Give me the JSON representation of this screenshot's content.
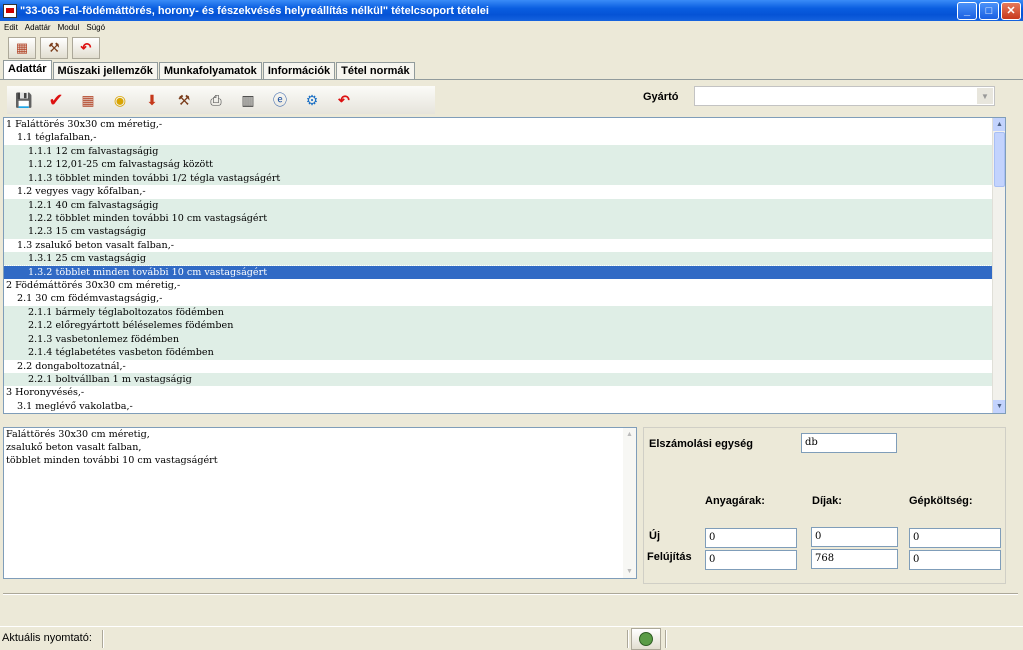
{
  "window": {
    "title": "\"33-063 Fal-födémáttörés, horony- és fészekvésés helyreállítás nélkül\" tételcsoport tételei",
    "minimize_glyph": "_",
    "maximize_glyph": "□",
    "close_glyph": "✕"
  },
  "menu": [
    "Edit",
    "Adattár",
    "Modul",
    "Súgó"
  ],
  "toolbar1": [
    {
      "icon": "bricks-icon",
      "glyph": "▦"
    },
    {
      "icon": "trowel-icon",
      "glyph": "⚒"
    },
    {
      "icon": "back-arrow-icon",
      "glyph": "↶"
    }
  ],
  "tabs": [
    "Adattár",
    "Műszaki jellemzők",
    "Munkafolyamatok",
    "Információk",
    "Tétel normák"
  ],
  "active_tab": "Adattár",
  "toolbar2": [
    {
      "icon": "save-icon",
      "glyph": "💾"
    },
    {
      "icon": "check-icon",
      "glyph": "✔"
    },
    {
      "icon": "bricks-icon",
      "glyph": "▦"
    },
    {
      "icon": "material-icon",
      "glyph": "◉"
    },
    {
      "icon": "import-icon",
      "glyph": "⬇"
    },
    {
      "icon": "tool-icon",
      "glyph": "⚒"
    },
    {
      "icon": "print-icon",
      "glyph": "⎙"
    },
    {
      "icon": "bar-chart-icon",
      "glyph": "▥"
    },
    {
      "icon": "internet-icon",
      "glyph": "ⓔ"
    },
    {
      "icon": "machine-icon",
      "glyph": "⚙"
    },
    {
      "icon": "back-arrow-icon",
      "glyph": "↶"
    }
  ],
  "gyarto": {
    "label": "Gyártó",
    "value": ""
  },
  "tree": [
    {
      "text": "1 Faláttörés 30x30 cm méretig,-",
      "level": 0,
      "alt": false
    },
    {
      "text": "1.1 téglafalban,-",
      "level": 1,
      "alt": false
    },
    {
      "text": "1.1.1 12 cm falvastagságig",
      "level": 2,
      "alt": true
    },
    {
      "text": "1.1.2 12,01-25 cm falvastagság között",
      "level": 2,
      "alt": true
    },
    {
      "text": "1.1.3 többlet minden további 1/2 tégla vastagságért",
      "level": 2,
      "alt": true
    },
    {
      "text": "1.2 vegyes vagy kőfalban,-",
      "level": 1,
      "alt": false
    },
    {
      "text": "1.2.1 40 cm falvastagságig",
      "level": 2,
      "alt": true
    },
    {
      "text": "1.2.2 többlet minden további 10 cm vastagságért",
      "level": 2,
      "alt": true
    },
    {
      "text": "1.2.3 15 cm vastagságig",
      "level": 2,
      "alt": true
    },
    {
      "text": "1.3 zsalukő beton vasalt falban,-",
      "level": 1,
      "alt": false
    },
    {
      "text": "1.3.1 25 cm vastagságig",
      "level": 2,
      "alt": true
    },
    {
      "text": "1.3.2 többlet minden további 10 cm vastagságért",
      "level": 2,
      "alt": false,
      "selected": true
    },
    {
      "text": "2 Födémáttörés 30x30 cm méretig,-",
      "level": 0,
      "alt": false
    },
    {
      "text": "2.1 30 cm födémvastagságig,-",
      "level": 1,
      "alt": false
    },
    {
      "text": "2.1.1 bármely téglaboltozatos födémben",
      "level": 2,
      "alt": true
    },
    {
      "text": "2.1.2 előregyártott béléselemes födémben",
      "level": 2,
      "alt": true
    },
    {
      "text": "2.1.3 vasbetonlemez födémben",
      "level": 2,
      "alt": true
    },
    {
      "text": "2.1.4 téglabetétes vasbeton födémben",
      "level": 2,
      "alt": true
    },
    {
      "text": "2.2 dongaboltozatnál,-",
      "level": 1,
      "alt": false
    },
    {
      "text": "2.2.1 boltvállban 1 m vastagságig",
      "level": 2,
      "alt": true
    },
    {
      "text": "3 Horonyvésés,-",
      "level": 0,
      "alt": false
    },
    {
      "text": "3.1 meglévő vakolatba,-",
      "level": 1,
      "alt": false
    }
  ],
  "description": [
    "Faláttörés 30x30 cm méretig,",
    "zsalukő beton vasalt falban,",
    "többlet minden további 10 cm vastagságért"
  ],
  "details": {
    "unit_label": "Elszámolási egység",
    "unit_value": "db",
    "col_material": "Anyagárak:",
    "col_fees": "Díjak:",
    "col_machine": "Gépköltség:",
    "row_new": "Új",
    "row_renovation": "Felújítás",
    "new": {
      "material": "0",
      "fees": "0",
      "machine": "0"
    },
    "renovation": {
      "material": "0",
      "fees": "768",
      "machine": "0"
    }
  },
  "status": {
    "printer_label": "Aktuális nyomtató:"
  }
}
